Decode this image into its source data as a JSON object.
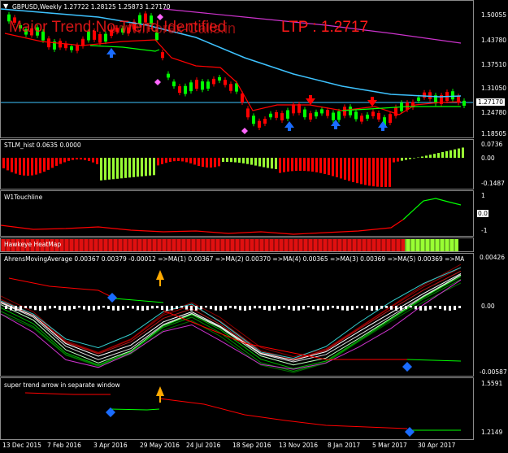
{
  "main": {
    "symbol_line": "GBPUSD,Weekly  1.27722 1.28125 1.25873 1.27170",
    "trend_text": "Major Trend:No Trend Identified",
    "watermark": "www.Forex-Calls.in",
    "ltp_text": "LTP : 1.2717",
    "price_label": "1.27170",
    "ticks": [
      "1.50055",
      "1.43780",
      "1.37510",
      "1.31050",
      "1.24780",
      "1.18505"
    ]
  },
  "stlm": {
    "title": "STLM_hist 0.0635 0.0000",
    "ticks": [
      "0.0736",
      "0.00",
      "-0.1487"
    ]
  },
  "w1": {
    "title": "W1Touchline",
    "ticks": [
      "1",
      "0.0",
      "-1"
    ]
  },
  "hawkeye": {
    "title": "Hawkeye HeatMap"
  },
  "ahrens": {
    "title": "AhrensMovingAverage 0.00367 0.00379 -0.00012  =>MA(1) 0.00367  =>MA(2) 0.00370  =>MA(4) 0.00365  =>MA(3) 0.00369  =>MA(5) 0.00369  =>MA",
    "ticks": [
      "0.00426",
      "0.00",
      "-0.00587"
    ]
  },
  "supertrend": {
    "title": "super trend arrow in separate window",
    "ticks": [
      "1.5591",
      "1.2149"
    ]
  },
  "dates": [
    "13 Dec 2015",
    "7 Feb 2016",
    "3 Apr 2016",
    "29 May 2016",
    "24 Jul 2016",
    "18 Sep 2016",
    "13 Nov 2016",
    "8 Jan 2017",
    "5 Mar 2017",
    "30 Apr 2017"
  ],
  "colors": {
    "bull": "#00ff00",
    "bear": "#ff0000",
    "ma_blue": "#3ec3ff",
    "ma_magenta": "#cc33cc",
    "arrow_blue": "#1a6cff",
    "arrow_red": "#ff0000",
    "lime": "#99ff33"
  }
}
